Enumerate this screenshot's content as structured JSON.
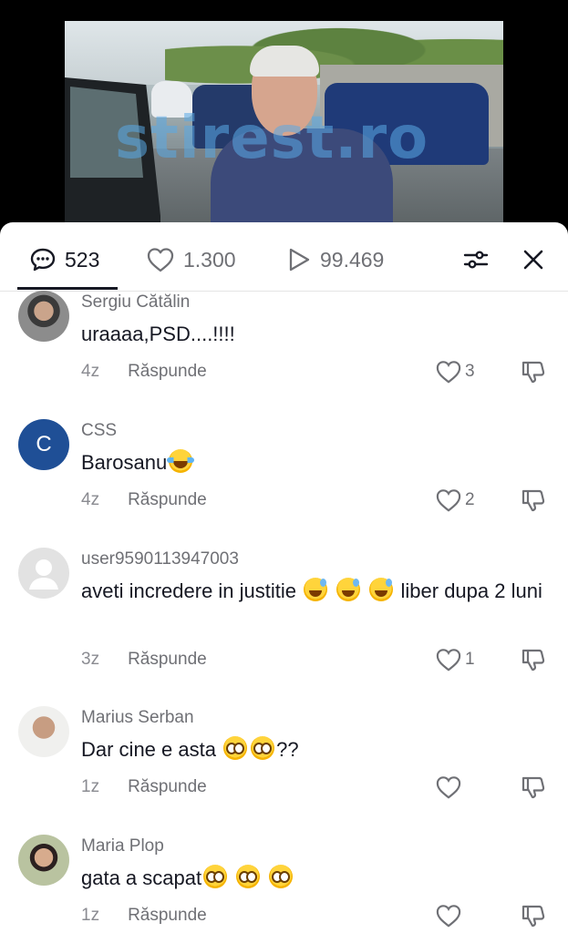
{
  "video": {
    "watermark": "stirest.ro"
  },
  "tabs": {
    "comments_count": "523",
    "likes_count": "1.300",
    "views_count": "99.469"
  },
  "comments": [
    {
      "username": "Sergiu Cătălin",
      "text": "uraaaa,PSD....!!!!",
      "age": "4z",
      "reply": "Răspunde",
      "likes": "3"
    },
    {
      "username": "CSS",
      "avatar_letter": "C",
      "text": "Barosanu",
      "age": "4z",
      "reply": "Răspunde",
      "likes": "2"
    },
    {
      "username": "user9590113947003",
      "text_a": "aveti incredere in justitie",
      "text_b": "liber dupa 2 luni",
      "age": "3z",
      "reply": "Răspunde",
      "likes": "1"
    },
    {
      "username": "Marius Serban",
      "text_a": "Dar cine e asta",
      "text_b": "??",
      "age": "1z",
      "reply": "Răspunde",
      "likes": ""
    },
    {
      "username": "Maria Plop",
      "text": "gata a scapat",
      "age": "1z",
      "reply": "Răspunde",
      "likes": ""
    }
  ],
  "colors": {
    "text": "#161823",
    "muted": "#6f7075",
    "avatar_css": "#1f4f96"
  },
  "icons": [
    "comment-icon",
    "heart-icon",
    "play-icon",
    "filter-icon",
    "close-icon",
    "dislike-icon",
    "emoji-joy",
    "emoji-sweat-smile",
    "emoji-flushed"
  ]
}
